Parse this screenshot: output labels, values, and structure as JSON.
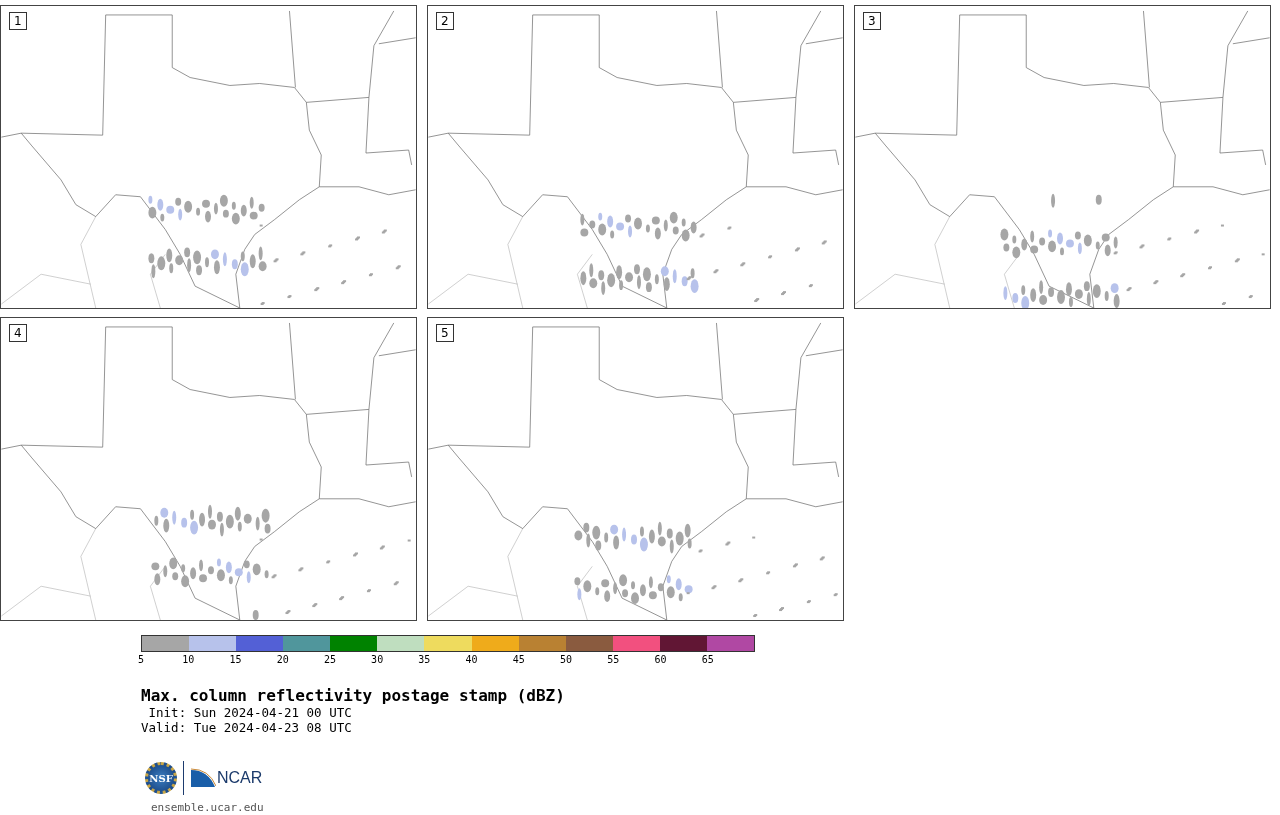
{
  "panels": [
    {
      "label": "1"
    },
    {
      "label": "2"
    },
    {
      "label": "3"
    },
    {
      "label": "4"
    },
    {
      "label": "5"
    }
  ],
  "colorbar": {
    "bins": [
      {
        "color": "#a6a6a6"
      },
      {
        "color": "#b7c2eb"
      },
      {
        "color": "#5360d6"
      },
      {
        "color": "#50969c"
      },
      {
        "color": "#008200"
      },
      {
        "color": "#bfdebf"
      },
      {
        "color": "#eedb5e"
      },
      {
        "color": "#efab1b"
      },
      {
        "color": "#b98132"
      },
      {
        "color": "#8a5b3f"
      },
      {
        "color": "#f2507f"
      },
      {
        "color": "#611634"
      },
      {
        "color": "#b048a3"
      }
    ],
    "ticks": [
      "5",
      "10",
      "15",
      "20",
      "25",
      "30",
      "35",
      "40",
      "45",
      "50",
      "55",
      "60",
      "65"
    ]
  },
  "title": "Max. column reflectivity postage stamp (dBZ)",
  "init": " Init: Sun 2024-04-21 00 UTC",
  "valid": "Valid: Tue 2024-04-23 08 UTC",
  "logos": {
    "nsf": "NSF",
    "ncar": "NCAR"
  },
  "url": "ensemble.ucar.edu"
}
